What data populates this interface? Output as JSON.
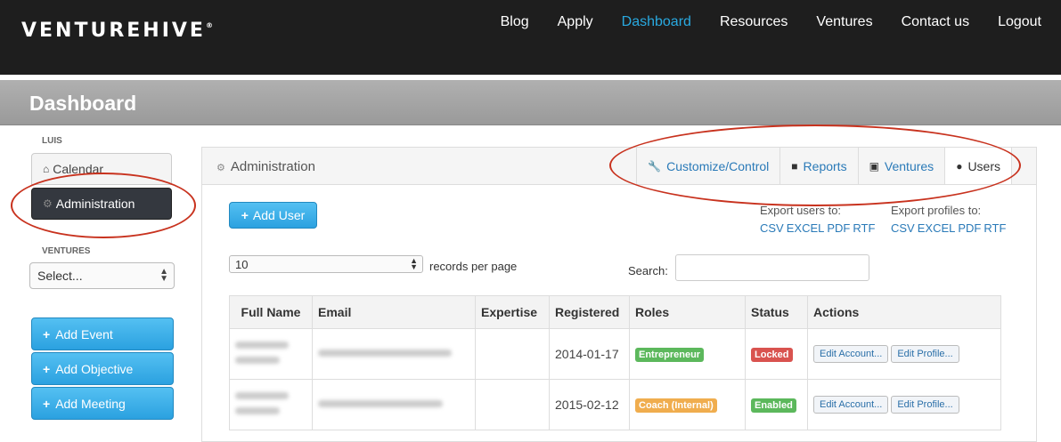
{
  "brand": {
    "logo_text": "VENTUREHIVE",
    "trademark": "®"
  },
  "nav": {
    "items": [
      "Blog",
      "Apply",
      "Dashboard",
      "Resources",
      "Ventures",
      "Contact us",
      "Logout"
    ],
    "active": "Dashboard",
    "active_color": "#29a9e0"
  },
  "page_title": "Dashboard",
  "sidebar": {
    "user_label": "LUIS",
    "items": [
      {
        "label": "Calendar",
        "icon": "home-icon"
      },
      {
        "label": "Administration",
        "icon": "gear-icon"
      }
    ],
    "ventures_label": "VENTURES",
    "ventures_select": "Select...",
    "buttons": [
      "Add Event",
      "Add Objective",
      "Add Meeting"
    ]
  },
  "panel": {
    "title": "Administration",
    "tabs": [
      {
        "label": "Customize/Control",
        "icon": "wrench-icon"
      },
      {
        "label": "Reports",
        "icon": "book-icon"
      },
      {
        "label": "Ventures",
        "icon": "briefcase-icon"
      },
      {
        "label": "Users",
        "icon": "user-icon"
      }
    ],
    "active_tab": "Users",
    "add_user_label": "Add User",
    "export_users": {
      "label": "Export users to:",
      "formats": [
        "CSV",
        "EXCEL",
        "PDF",
        "RTF"
      ]
    },
    "export_profiles": {
      "label": "Export profiles to:",
      "formats": [
        "CSV",
        "EXCEL",
        "PDF",
        "RTF"
      ]
    },
    "per_page_value": "10",
    "per_page_label": "records per page",
    "search_label": "Search:",
    "search_value": ""
  },
  "table": {
    "columns": [
      "Full Name",
      "Email",
      "Expertise",
      "Registered",
      "Roles",
      "Status",
      "Actions"
    ],
    "rows": [
      {
        "registered": "2014-01-17",
        "role": "Entrepreneur",
        "role_color": "#5cb85c",
        "status": "Locked",
        "status_color": "#d9534f"
      },
      {
        "registered": "2015-02-12",
        "role": "Coach (Internal)",
        "role_color": "#f0ad4e",
        "status": "Enabled",
        "status_color": "#5cb85c"
      }
    ],
    "actions": [
      "Edit Account...",
      "Edit Profile..."
    ]
  },
  "annotation_color": "#c8321e"
}
